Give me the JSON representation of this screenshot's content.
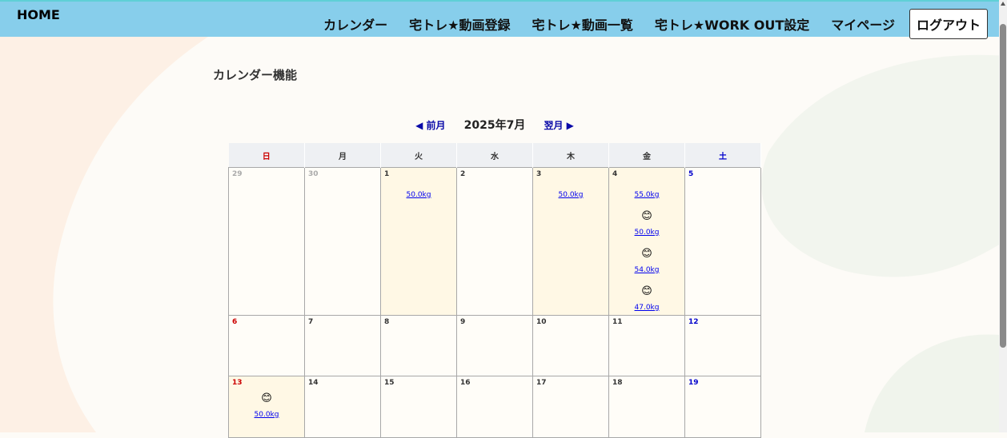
{
  "nav": {
    "home": "HOME",
    "items": [
      "カレンダー",
      "宅トレ★動画登録",
      "宅トレ★動画一覧",
      "宅トレ★WORK OUT設定",
      "マイページ"
    ],
    "logout": "ログアウト"
  },
  "page": {
    "title": "カレンダー機能"
  },
  "calendar": {
    "prev": "◀ 前月",
    "current": "2025年7月",
    "next": "翌月 ▶",
    "weekdays": [
      "日",
      "月",
      "火",
      "水",
      "木",
      "金",
      "土"
    ],
    "rows": [
      [
        {
          "day": "29",
          "entries": []
        },
        {
          "day": "30",
          "entries": []
        },
        {
          "day": "1",
          "entries": [
            {
              "emoji": "",
              "weight": "50.0kg"
            }
          ]
        },
        {
          "day": "2",
          "entries": []
        },
        {
          "day": "3",
          "entries": [
            {
              "emoji": "",
              "weight": "50.0kg"
            }
          ]
        },
        {
          "day": "4",
          "entries": [
            {
              "emoji": "",
              "weight": "55.0kg"
            },
            {
              "emoji": "😊",
              "weight": "50.0kg"
            },
            {
              "emoji": "😊",
              "weight": "54.0kg"
            },
            {
              "emoji": "😊",
              "weight": "47.0kg"
            }
          ]
        },
        {
          "day": "5",
          "entries": []
        }
      ],
      [
        {
          "day": "6",
          "entries": []
        },
        {
          "day": "7",
          "entries": []
        },
        {
          "day": "8",
          "entries": []
        },
        {
          "day": "9",
          "entries": []
        },
        {
          "day": "10",
          "entries": []
        },
        {
          "day": "11",
          "entries": []
        },
        {
          "day": "12",
          "entries": []
        }
      ],
      [
        {
          "day": "13",
          "entries": [
            {
              "emoji": "😊",
              "weight": "50.0kg"
            }
          ]
        },
        {
          "day": "14",
          "entries": []
        },
        {
          "day": "15",
          "entries": []
        },
        {
          "day": "16",
          "entries": []
        },
        {
          "day": "17",
          "entries": []
        },
        {
          "day": "18",
          "entries": []
        },
        {
          "day": "19",
          "entries": []
        }
      ]
    ]
  },
  "colors": {
    "header": "#87ceeb",
    "sunday": "#cc0000",
    "saturday": "#0000cc",
    "link": "#0000ee",
    "highlight_cell": "#fff8e5"
  }
}
